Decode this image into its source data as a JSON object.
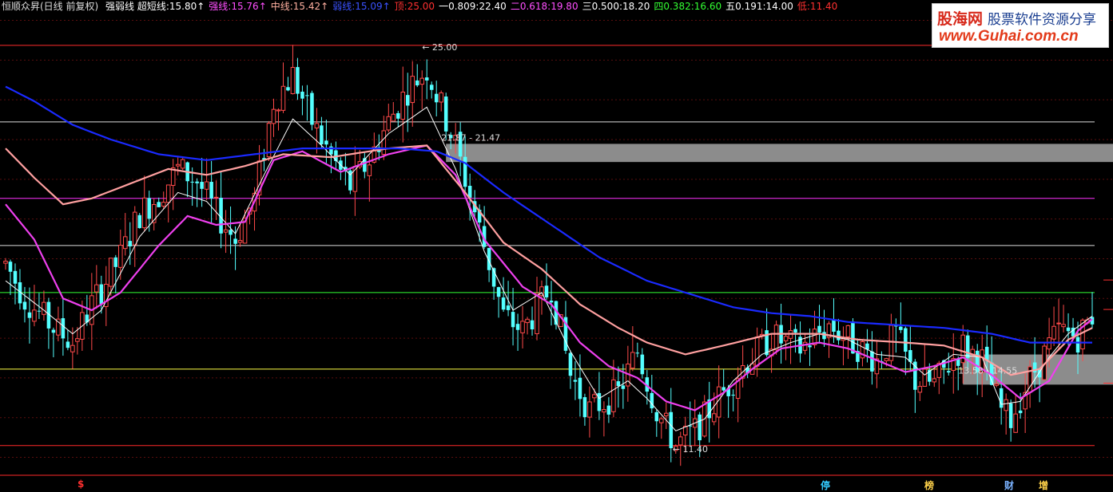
{
  "header": {
    "title": "恒顺众昇(日线 前复权)",
    "items": [
      {
        "label": "强弱线 超短线:",
        "value": "15.80",
        "arrow": "↑",
        "color": "#ffffff"
      },
      {
        "label": "强线:",
        "value": "15.76",
        "arrow": "↑",
        "color": "#ff4fff"
      },
      {
        "label": "中线:",
        "value": "15.42",
        "arrow": "↑",
        "color": "#ffb0a0"
      },
      {
        "label": "弱线:",
        "value": "15.09",
        "arrow": "↑",
        "color": "#3a52ff"
      },
      {
        "label": "顶:",
        "value": "25.00",
        "arrow": "",
        "color": "#ff3030"
      },
      {
        "label": "一0.809:",
        "value": "22.40",
        "arrow": "",
        "color": "#ffffff"
      },
      {
        "label": "二0.618:",
        "value": "19.80",
        "arrow": "",
        "color": "#ff4fff"
      },
      {
        "label": "三0.500:",
        "value": "18.20",
        "arrow": "",
        "color": "#ffffff"
      },
      {
        "label": "四0.382:",
        "value": "16.60",
        "arrow": "",
        "color": "#33ff33"
      },
      {
        "label": "五0.191:",
        "value": "14.00",
        "arrow": "",
        "color": "#ffffff"
      },
      {
        "label": "低:",
        "value": "11.40",
        "arrow": "",
        "color": "#ff3030"
      }
    ]
  },
  "logo": {
    "name": "股海网",
    "slogan": "股票软件资源分享",
    "url": "www.Guhai.com.cn"
  },
  "markers": [
    {
      "text": "$",
      "color": "#ff3030"
    },
    {
      "text": "停",
      "color": "#33ccff"
    },
    {
      "text": "榜",
      "color": "#ffd24a"
    },
    {
      "text": "财",
      "color": "#7ab2ff"
    },
    {
      "text": "增",
      "color": "#ffd24a"
    }
  ],
  "chart_data": {
    "type": "candlestick",
    "ylim": [
      10.5,
      26.0
    ],
    "candle_count": 228,
    "levels": [
      {
        "name": "顶",
        "value": 25.0,
        "color": "#ff2a2a"
      },
      {
        "name": "一",
        "value": 22.4,
        "color": "#dddddd"
      },
      {
        "name": "二",
        "value": 19.8,
        "color": "#ff33ff"
      },
      {
        "name": "三",
        "value": 18.2,
        "color": "#dddddd"
      },
      {
        "name": "四",
        "value": 16.6,
        "color": "#33ff33"
      },
      {
        "name": "五",
        "value": 14.0,
        "color": "#ffff44"
      },
      {
        "name": "低",
        "value": 11.4,
        "color": "#ff2a2a"
      }
    ],
    "annotations": [
      {
        "text": "25.00",
        "value": 25.0
      },
      {
        "text": "21.87 - 21.47",
        "low": 21.47,
        "high": 21.87
      },
      {
        "text": "13.58 - 14.55",
        "low": 13.58,
        "high": 14.55
      },
      {
        "text": "11.40",
        "value": 11.4
      }
    ],
    "price_path": [
      [
        0,
        17.6
      ],
      [
        4,
        16.4
      ],
      [
        10,
        15.4
      ],
      [
        14,
        14.9
      ],
      [
        18,
        16.2
      ],
      [
        24,
        17.8
      ],
      [
        28,
        19.3
      ],
      [
        32,
        19.9
      ],
      [
        36,
        20.8
      ],
      [
        40,
        20.4
      ],
      [
        44,
        19.3
      ],
      [
        48,
        18.4
      ],
      [
        52,
        19.8
      ],
      [
        56,
        23.1
      ],
      [
        60,
        24.0
      ],
      [
        64,
        22.4
      ],
      [
        68,
        21.2
      ],
      [
        72,
        20.2
      ],
      [
        76,
        21.1
      ],
      [
        80,
        22.4
      ],
      [
        84,
        23.5
      ],
      [
        88,
        24.2
      ],
      [
        94,
        21.6
      ],
      [
        100,
        18.2
      ],
      [
        104,
        15.8
      ],
      [
        108,
        15.3
      ],
      [
        114,
        16.8
      ],
      [
        118,
        13.8
      ],
      [
        122,
        12.6
      ],
      [
        128,
        13.2
      ],
      [
        132,
        14.6
      ],
      [
        136,
        12.6
      ],
      [
        140,
        11.4
      ],
      [
        144,
        11.9
      ],
      [
        148,
        12.8
      ],
      [
        154,
        14.1
      ],
      [
        160,
        15.1
      ],
      [
        166,
        14.7
      ],
      [
        172,
        15.5
      ],
      [
        176,
        15.0
      ],
      [
        182,
        14.3
      ],
      [
        186,
        15.2
      ],
      [
        190,
        13.6
      ],
      [
        194,
        13.5
      ],
      [
        200,
        14.8
      ],
      [
        204,
        14.3
      ],
      [
        208,
        12.6
      ],
      [
        210,
        12.3
      ],
      [
        214,
        13.7
      ],
      [
        220,
        15.3
      ],
      [
        224,
        15.1
      ],
      [
        227,
        15.8
      ]
    ],
    "series": [
      {
        "name": "超短线",
        "color": "#ffffff",
        "last": 15.8,
        "path": [
          [
            0,
            17.0
          ],
          [
            8,
            16.0
          ],
          [
            14,
            15.2
          ],
          [
            20,
            16.0
          ],
          [
            28,
            18.5
          ],
          [
            36,
            20.0
          ],
          [
            42,
            19.7
          ],
          [
            48,
            18.6
          ],
          [
            54,
            20.6
          ],
          [
            60,
            22.5
          ],
          [
            66,
            21.6
          ],
          [
            72,
            20.6
          ],
          [
            80,
            22.0
          ],
          [
            88,
            22.9
          ],
          [
            94,
            20.8
          ],
          [
            100,
            18.0
          ],
          [
            106,
            16.0
          ],
          [
            112,
            16.6
          ],
          [
            118,
            14.6
          ],
          [
            124,
            13.0
          ],
          [
            130,
            13.6
          ],
          [
            134,
            13.0
          ],
          [
            140,
            11.9
          ],
          [
            146,
            12.3
          ],
          [
            152,
            13.6
          ],
          [
            158,
            14.5
          ],
          [
            164,
            14.9
          ],
          [
            170,
            15.2
          ],
          [
            176,
            15.0
          ],
          [
            182,
            14.5
          ],
          [
            188,
            14.4
          ],
          [
            192,
            13.8
          ],
          [
            198,
            14.5
          ],
          [
            204,
            14.4
          ],
          [
            208,
            12.8
          ],
          [
            212,
            12.9
          ],
          [
            218,
            14.4
          ],
          [
            222,
            15.2
          ],
          [
            227,
            15.8
          ]
        ]
      },
      {
        "name": "强线",
        "color": "#ee40ee",
        "last": 15.76,
        "path": [
          [
            0,
            19.6
          ],
          [
            6,
            18.4
          ],
          [
            12,
            16.4
          ],
          [
            18,
            16.0
          ],
          [
            24,
            16.6
          ],
          [
            32,
            18.2
          ],
          [
            38,
            19.2
          ],
          [
            44,
            18.9
          ],
          [
            50,
            19.0
          ],
          [
            56,
            21.1
          ],
          [
            62,
            21.4
          ],
          [
            70,
            20.7
          ],
          [
            80,
            21.3
          ],
          [
            88,
            21.6
          ],
          [
            94,
            20.6
          ],
          [
            100,
            18.4
          ],
          [
            108,
            16.8
          ],
          [
            114,
            16.2
          ],
          [
            120,
            14.9
          ],
          [
            126,
            14.1
          ],
          [
            132,
            13.7
          ],
          [
            138,
            12.9
          ],
          [
            144,
            12.6
          ],
          [
            150,
            13.2
          ],
          [
            156,
            14.0
          ],
          [
            162,
            14.7
          ],
          [
            170,
            14.9
          ],
          [
            176,
            14.7
          ],
          [
            182,
            14.3
          ],
          [
            188,
            13.9
          ],
          [
            194,
            14.1
          ],
          [
            200,
            14.4
          ],
          [
            206,
            13.8
          ],
          [
            212,
            13.0
          ],
          [
            218,
            13.6
          ],
          [
            224,
            15.3
          ],
          [
            227,
            15.7
          ]
        ]
      },
      {
        "name": "中线",
        "color": "#ffa0a0",
        "last": 15.42,
        "path": [
          [
            0,
            21.5
          ],
          [
            6,
            20.5
          ],
          [
            12,
            19.6
          ],
          [
            18,
            19.8
          ],
          [
            26,
            20.3
          ],
          [
            34,
            20.8
          ],
          [
            42,
            20.6
          ],
          [
            50,
            20.9
          ],
          [
            58,
            21.3
          ],
          [
            68,
            21.2
          ],
          [
            80,
            21.5
          ],
          [
            88,
            21.6
          ],
          [
            96,
            20.0
          ],
          [
            104,
            18.3
          ],
          [
            112,
            17.4
          ],
          [
            120,
            16.2
          ],
          [
            128,
            15.4
          ],
          [
            134,
            14.9
          ],
          [
            142,
            14.5
          ],
          [
            150,
            14.8
          ],
          [
            160,
            15.2
          ],
          [
            170,
            15.2
          ],
          [
            178,
            15.0
          ],
          [
            188,
            14.9
          ],
          [
            196,
            14.8
          ],
          [
            204,
            14.4
          ],
          [
            210,
            13.8
          ],
          [
            216,
            14.0
          ],
          [
            222,
            15.0
          ],
          [
            227,
            15.4
          ]
        ]
      },
      {
        "name": "弱线",
        "color": "#1a2aff",
        "last": 15.09,
        "path": [
          [
            0,
            23.6
          ],
          [
            6,
            23.1
          ],
          [
            14,
            22.3
          ],
          [
            22,
            21.8
          ],
          [
            32,
            21.3
          ],
          [
            42,
            21.1
          ],
          [
            52,
            21.3
          ],
          [
            62,
            21.5
          ],
          [
            72,
            21.5
          ],
          [
            82,
            21.5
          ],
          [
            90,
            21.4
          ],
          [
            96,
            21.0
          ],
          [
            104,
            20.0
          ],
          [
            114,
            18.9
          ],
          [
            124,
            17.8
          ],
          [
            134,
            17.0
          ],
          [
            144,
            16.5
          ],
          [
            152,
            16.1
          ],
          [
            160,
            15.9
          ],
          [
            168,
            15.8
          ],
          [
            176,
            15.6
          ],
          [
            186,
            15.5
          ],
          [
            196,
            15.4
          ],
          [
            206,
            15.2
          ],
          [
            214,
            14.9
          ],
          [
            222,
            14.9
          ],
          [
            227,
            14.9
          ]
        ]
      }
    ]
  }
}
